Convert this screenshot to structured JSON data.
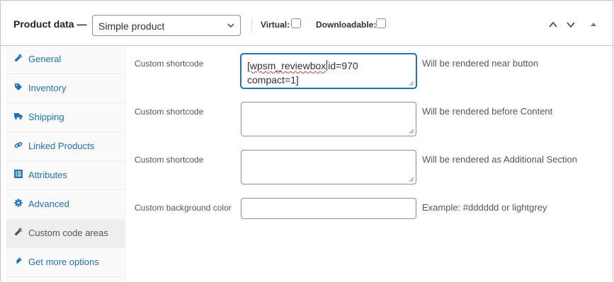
{
  "header": {
    "title": "Product data —",
    "product_type": "Simple product",
    "virtual_label": "Virtual:",
    "downloadable_label": "Downloadable:"
  },
  "sidebar": {
    "items": [
      {
        "label": "General",
        "icon": "wrench-icon"
      },
      {
        "label": "Inventory",
        "icon": "tag-icon"
      },
      {
        "label": "Shipping",
        "icon": "truck-icon"
      },
      {
        "label": "Linked Products",
        "icon": "link-icon"
      },
      {
        "label": "Attributes",
        "icon": "list-icon"
      },
      {
        "label": "Advanced",
        "icon": "gear-icon"
      },
      {
        "label": "Custom code areas",
        "icon": "wrench-icon",
        "active": true
      },
      {
        "label": "Get more options",
        "icon": "plugin-icon"
      }
    ]
  },
  "fields": [
    {
      "label": "Custom shortcode",
      "value_part1": "[wpsm_reviewbox",
      "value_part2": "id=970",
      "value_line2": "compact=1]",
      "description": "Will be rendered near button"
    },
    {
      "label": "Custom shortcode",
      "value": "",
      "description": "Will be rendered before Content"
    },
    {
      "label": "Custom shortcode",
      "value": "",
      "description": "Will be rendered as Additional Section"
    },
    {
      "label": "Custom background color",
      "value": "",
      "description": "Example: #dddddd or lightgrey"
    }
  ],
  "colors": {
    "link": "#2271b1",
    "focus_border": "#2271b1",
    "border": "#c3c4c7",
    "spellcheck": "#d63638"
  }
}
